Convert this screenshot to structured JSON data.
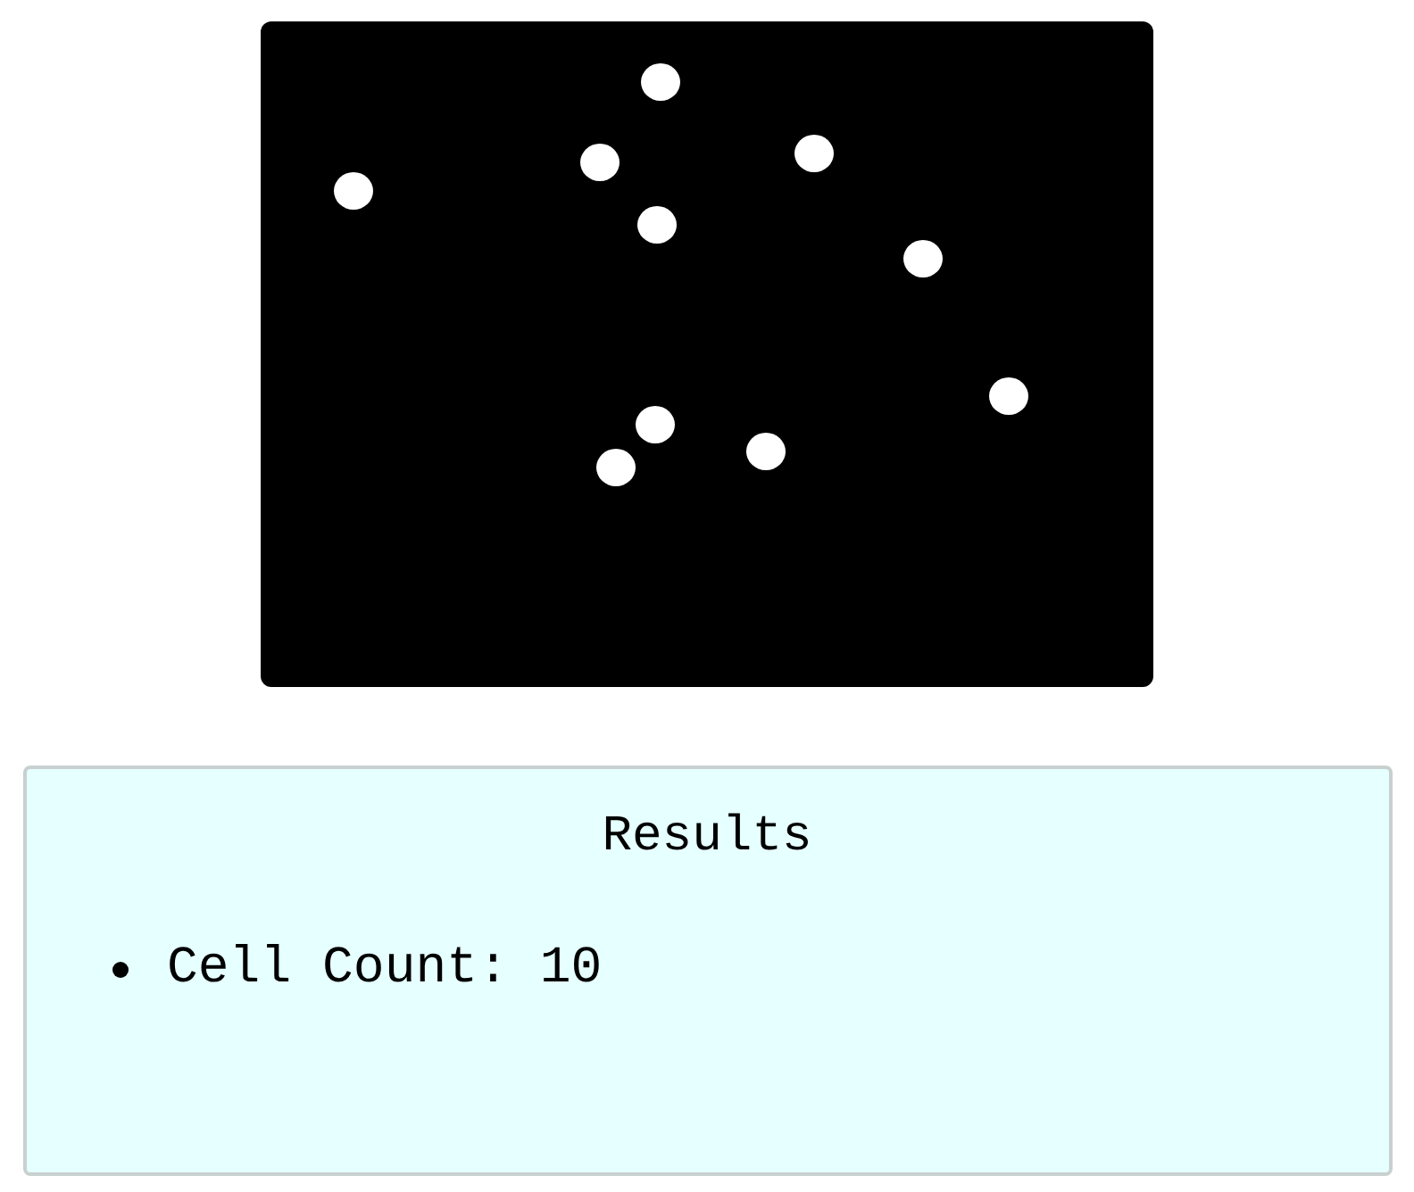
{
  "image": {
    "kind": "cell-mask"
  },
  "results": {
    "title": "Results",
    "items": [
      "Cell Count: 10"
    ]
  }
}
